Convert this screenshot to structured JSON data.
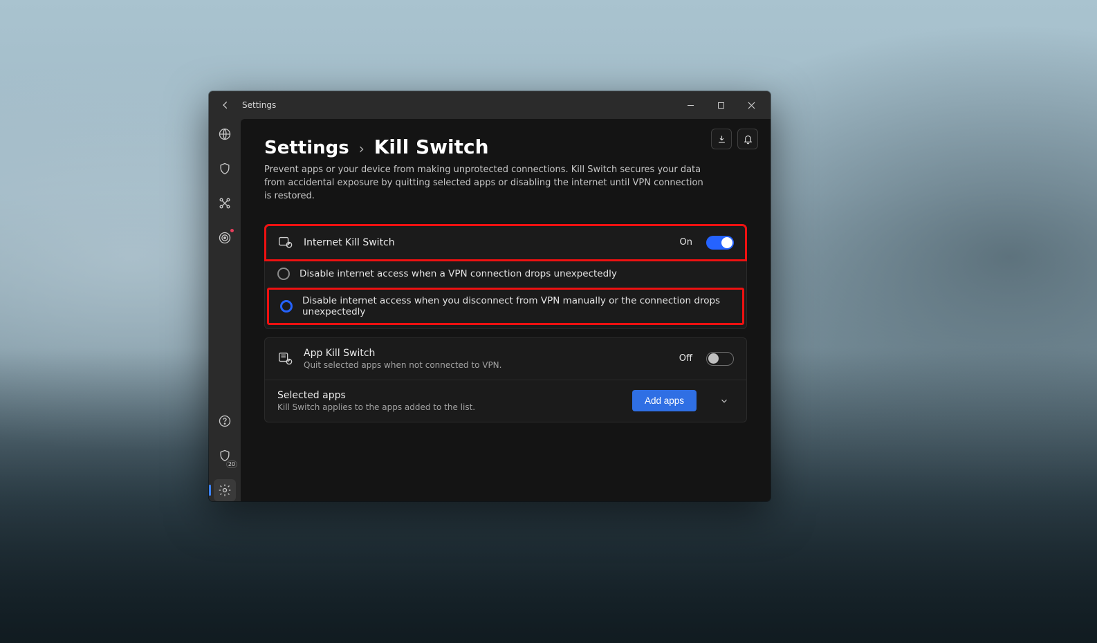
{
  "window": {
    "title": "Settings"
  },
  "sidebar": {
    "items": [
      {
        "name": "globe-icon"
      },
      {
        "name": "shield-icon"
      },
      {
        "name": "meshnet-icon"
      },
      {
        "name": "target-icon",
        "has_dot": true
      }
    ],
    "bottom": [
      {
        "name": "help-icon"
      },
      {
        "name": "shield-count-icon",
        "badge": "20"
      },
      {
        "name": "gear-icon",
        "active": true
      }
    ]
  },
  "breadcrumb": {
    "root": "Settings",
    "leaf": "Kill Switch"
  },
  "description": "Prevent apps or your device from making unprotected connections. Kill Switch secures your data from accidental exposure by quitting selected apps or disabling the internet until VPN connection is restored.",
  "internet_ks": {
    "title": "Internet Kill Switch",
    "state_label": "On",
    "state": true,
    "options": [
      {
        "label": "Disable internet access when a VPN connection drops unexpectedly",
        "selected": false
      },
      {
        "label": "Disable internet access when you disconnect from VPN manually or the connection drops unexpectedly",
        "selected": true
      }
    ]
  },
  "app_ks": {
    "title": "App Kill Switch",
    "subtitle": "Quit selected apps when not connected to VPN.",
    "state_label": "Off",
    "state": false
  },
  "selected_apps": {
    "title": "Selected apps",
    "subtitle": "Kill Switch applies to the apps added to the list.",
    "button": "Add apps"
  },
  "highlights": {
    "internet_panel": true,
    "option_index": 1
  }
}
